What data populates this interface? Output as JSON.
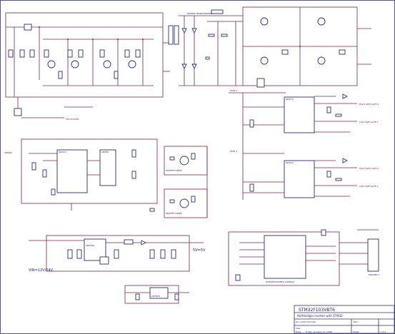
{
  "title_block": {
    "title": "STM32F103VBT6",
    "subtitle": "Half-bridge inverter with STM32",
    "label_document": "Document Number",
    "label_rev": "Rev",
    "label_size": "Size",
    "label_date": "Date:",
    "label_sheet": "Sheet",
    "date_value": "Friday, January 11, 2008",
    "sheet_value": "1 of 1"
  },
  "labels": {
    "vin": "VIN=12V/24V",
    "vout_5v": "5V=5V",
    "isense": "ISENSE",
    "power_transformer": "POWER TRANSFORMER",
    "mcu": "STM32F103VBT6_LQFP100",
    "ir2110_a": "IR2110",
    "ir2110_b": "IR2110",
    "ir2110_c": "IR2110",
    "lm7805": "LM7805",
    "regulator": "LM2596",
    "mosfet_a": "MOSFET DRIVE",
    "mosfet_b": "MOSFET DRIVE",
    "gate_hi_1": "HIGH SIDE GATE 1",
    "gate_lo_1": "LOW SIDE GATE 1",
    "gate_hi_2": "HIGH SIDE GATE 2",
    "gate_lo_2": "LOW SIDE GATE 2",
    "pwm_1": "PWM 1",
    "pwm_2": "PWM 2",
    "sd": "SHUTDOWN",
    "header": "HEADER 5",
    "opamp": "LM358"
  },
  "colors": {
    "wire": "#8a1f4a",
    "component": "#2a2a8c",
    "text": "#1a1a7a",
    "power_label": "#b01030"
  }
}
